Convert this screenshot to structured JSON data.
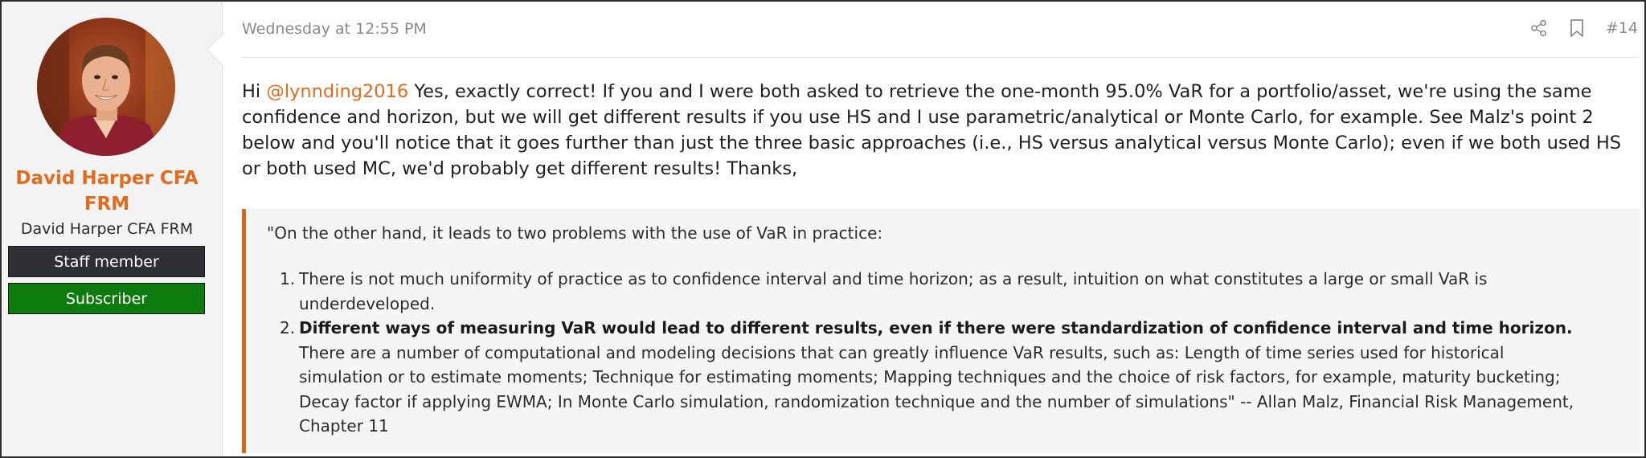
{
  "user": {
    "name": "David Harper CFA FRM",
    "title": "David Harper CFA FRM",
    "banners": {
      "staff": "Staff member",
      "subscriber": "Subscriber"
    },
    "name_color": "#e06c1f",
    "staff_color": "#2e2f35",
    "subscriber_color": "#0e7b0e"
  },
  "post": {
    "date": "Wednesday at 12:55 PM",
    "number": "#14",
    "actions": [
      "share-icon",
      "bookmark-icon"
    ],
    "message": {
      "greeting": "Hi ",
      "mention": "@lynnding2016",
      "body": " Yes, exactly correct! If you and I were both asked to retrieve the one-month 95.0% VaR for a portfolio/asset, we're using the same confidence and horizon, but we will get different results if you use HS and I use parametric/analytical or Monte Carlo, for example. See Malz's point 2 below and you'll notice that it goes further than just the three basic approaches (i.e., HS versus analytical versus Monte Carlo); even if we both used HS or both used MC, we'd probably get different results! Thanks,"
    },
    "quote": {
      "intro": "\"On the other hand, it leads to two problems with the use of VaR in practice:",
      "items": [
        {
          "number": "1.",
          "bold": "",
          "text": "There is not much uniformity of practice as to confidence interval and time horizon; as a result, intuition on what constitutes a large or small VaR is underdeveloped."
        },
        {
          "number": "2.",
          "bold": "Different ways of measuring VaR would lead to different results, even if there were standardization of confidence interval and time horizon.",
          "text": " There are a number of computational and modeling decisions that can greatly influence VaR results, such as: Length of time series used for historical simulation or to estimate moments; Technique for estimating moments; Mapping techniques and the choice of risk factors, for example, maturity bucketing; Decay factor if applying EWMA; In Monte Carlo simulation, randomization technique and the number of simulations\" -- Allan Malz, Financial Risk Management, Chapter 11"
        }
      ],
      "accent_color": "#d9661a"
    }
  }
}
